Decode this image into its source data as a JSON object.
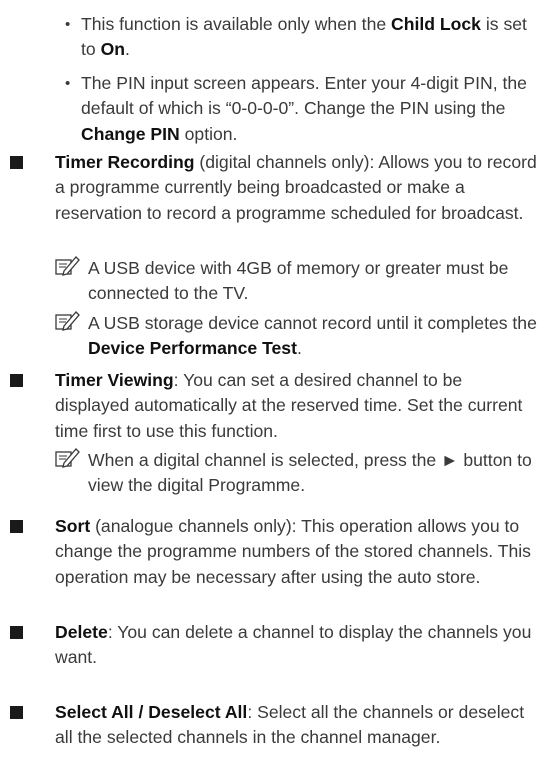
{
  "notes_top": [
    {
      "pre": "This function is available only when the ",
      "b1": "Child Lock",
      "mid": " is set to ",
      "b2": "On",
      "post": "."
    },
    {
      "pre": "The PIN input screen appears. Enter your 4-digit PIN, the default of which is “0-0-0-0”. Change the PIN using the ",
      "b1": "Change PIN",
      "post": " option."
    }
  ],
  "items": {
    "timer_recording": {
      "title": "Timer Recording",
      "text": " (digital channels only): Allows you to record a programme currently being broadcasted or make a reservation to record a programme scheduled for broadcast.",
      "note1": "A USB device with 4GB of memory or greater must be connected to the TV.",
      "note2_pre": "A USB storage device cannot record until it completes the ",
      "note2_bold": "Device Performance Test",
      "note2_post": "."
    },
    "timer_viewing": {
      "title": "Timer Viewing",
      "text": ": You can set a desired channel to be displayed automatically at the reserved time. Set the current time first to use this function.",
      "note": "When a digital channel is selected, press the ► button to view the digital Programme."
    },
    "sort": {
      "title": "Sort",
      "text": " (analogue channels only): This operation allows you to change the programme numbers of the stored channels. This operation may be necessary after using the auto store."
    },
    "delete": {
      "title": "Delete",
      "text": ": You can delete a channel to display the channels you want."
    },
    "select_all": {
      "title": "Select All / Deselect All",
      "text": ": Select all the channels or deselect all the selected channels in the channel manager."
    }
  },
  "icons": {
    "bullet": "bullet-dot",
    "section": "black-square",
    "note": "pencil-note-icon"
  }
}
